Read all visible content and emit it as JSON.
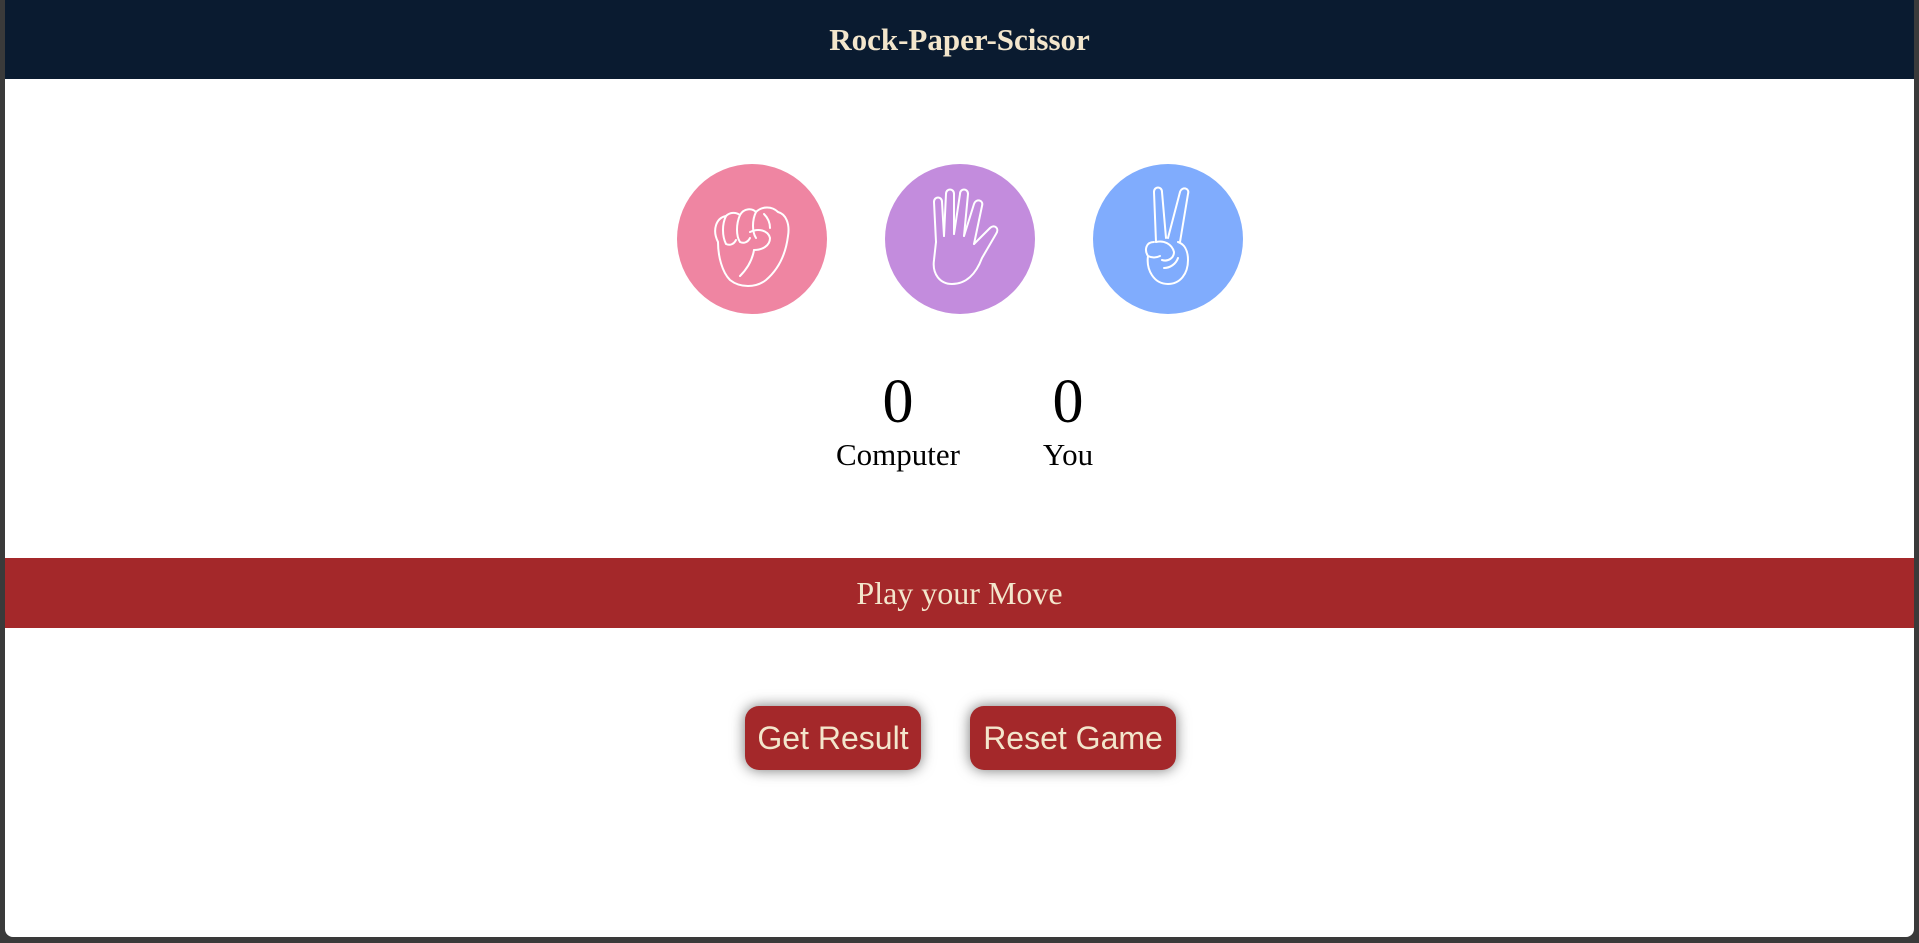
{
  "header": {
    "title": "Rock-Paper-Scissor",
    "bg_color": "#0a1b30"
  },
  "choices": [
    {
      "id": "rock",
      "icon": "fist-icon",
      "color": "#ef85a2"
    },
    {
      "id": "paper",
      "icon": "open-hand-icon",
      "color": "#c38cdd"
    },
    {
      "id": "scissors",
      "icon": "victory-hand-icon",
      "color": "#80acfd"
    }
  ],
  "scoreboard": {
    "computer": {
      "score": "0",
      "label": "Computer"
    },
    "user": {
      "score": "0",
      "label": "You"
    }
  },
  "message": {
    "text": "Play your Move",
    "bg_color": "#a4282a"
  },
  "buttons": {
    "get_result": "Get Result",
    "reset": "Reset Game",
    "bg_color": "#a4282a"
  }
}
